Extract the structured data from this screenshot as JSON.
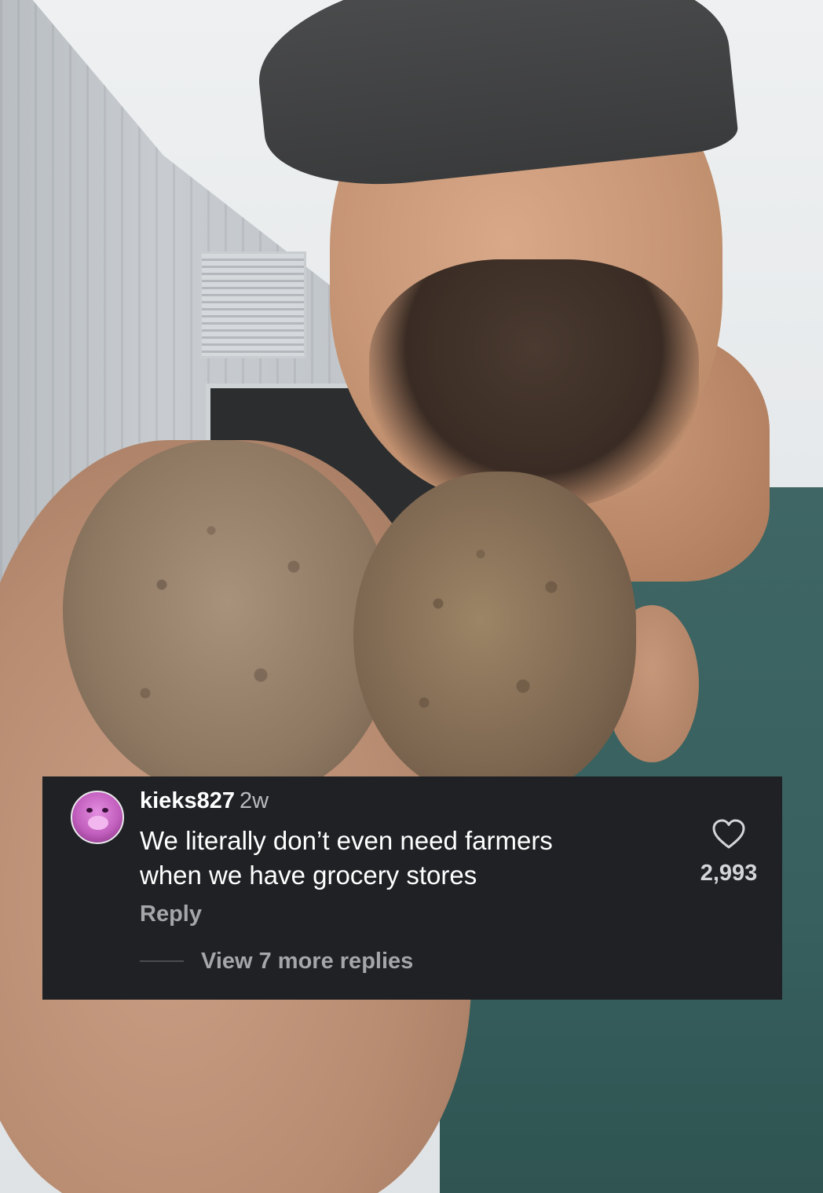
{
  "comment": {
    "username": "kieks827",
    "timestamp": "2w",
    "text_line1": "We literally don’t even need farmers",
    "text_line2": "when we have grocery stores",
    "reply_label": "Reply",
    "view_replies_label": "View 7 more replies",
    "like_count": "2,993",
    "like_icon": "heart-outline-icon",
    "card_background": "#1f2125"
  }
}
